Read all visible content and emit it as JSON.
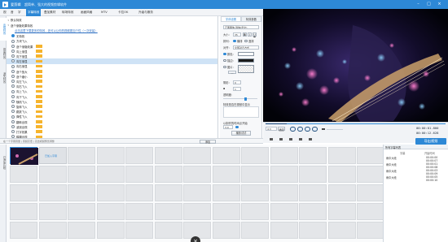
{
  "titlebar": {
    "app": "爱剪辑",
    "subtitle": "超简单、强大的视频剪辑软件"
  },
  "menu": [
    "视",
    "音",
    "字",
    "字幕特效",
    "叠加素材",
    "转场特效",
    "画面风格",
    "MTV",
    "卡拉OK",
    "升级与服务"
  ],
  "menu_active_index": 3,
  "left_tabs": [
    "出现特效",
    "停留特效",
    "消失特效"
  ],
  "effects": {
    "header": "默认特效",
    "group": "逐个渐隐效果特效",
    "promo": "点击这里下载更多的特效，还可以让你的视频更加个性（一次安装）",
    "items": [
      {
        "label": "无特效",
        "tag": false,
        "indent": 1,
        "checked": true
      },
      {
        "label": "方块飞入",
        "tag": false,
        "indent": 1,
        "checked": false
      },
      {
        "label": "逐个渐隐效果",
        "tag": true,
        "indent": 1,
        "checked": false
      },
      {
        "label": "向上渐显",
        "tag": true,
        "indent": 1,
        "checked": false
      },
      {
        "label": "向下渐显",
        "tag": true,
        "indent": 1,
        "checked": false
      },
      {
        "label": "向左渐显",
        "tag": true,
        "indent": 1,
        "checked": false
      },
      {
        "label": "向右渐显",
        "tag": true,
        "indent": 1,
        "checked": false
      },
      {
        "label": "逐个放大",
        "tag": true,
        "indent": 1,
        "checked": false
      },
      {
        "label": "逐个缩小",
        "tag": true,
        "indent": 1,
        "checked": false
      },
      {
        "label": "向左飞入",
        "tag": true,
        "indent": 1,
        "checked": false
      },
      {
        "label": "向右飞入",
        "tag": true,
        "indent": 1,
        "checked": false
      },
      {
        "label": "向上飞入",
        "tag": true,
        "indent": 1,
        "checked": false
      },
      {
        "label": "向下飞入",
        "tag": true,
        "indent": 1,
        "checked": false
      },
      {
        "label": "随机飞入",
        "tag": true,
        "indent": 1,
        "checked": false
      },
      {
        "label": "旋转飞入",
        "tag": true,
        "indent": 1,
        "checked": false
      },
      {
        "label": "跳跃飞入",
        "tag": true,
        "indent": 1,
        "checked": false
      },
      {
        "label": "弹性飞入",
        "tag": true,
        "indent": 1,
        "checked": false
      },
      {
        "label": "翻转出现",
        "tag": true,
        "indent": 1,
        "checked": false
      },
      {
        "label": "波浪出现",
        "tag": true,
        "indent": 1,
        "checked": false
      },
      {
        "label": "打字效果",
        "tag": true,
        "indent": 1,
        "checked": false
      },
      {
        "label": "模糊出现",
        "tag": true,
        "indent": 1,
        "checked": false
      }
    ],
    "selected_index": 5
  },
  "props": {
    "tabs": [
      "字体设置",
      "特效参数"
    ],
    "font_select": "正黑黑体-简体(华文)",
    "size_label": "大小：",
    "size_value": "35",
    "align_label": "排列：",
    "align_h": "横排",
    "align_v": "竖排",
    "anchor_label": "对齐：",
    "anchor_value": "全部对齐方式",
    "color_label": "颜色：",
    "shadow_label": "描边：",
    "bg_label": "图片：",
    "font_color": "#ffffff",
    "stroke_color": "#1a1a1a",
    "shadow_label2": "阴影：",
    "opacity_label": "透明度：",
    "opt1": "特效是否在视频中显示",
    "opt2": "打开字幕显示位置",
    "bottom_label": "以制作的时间点开始",
    "duration_value": "3.0",
    "apply_btn": "播放试试"
  },
  "player": {
    "ratio": "4:3",
    "fit": "适应",
    "current_time": "00:00:01.800",
    "total_time": "00:00:12.628"
  },
  "addbar": {
    "hint": "在一个字幕音量 | 音频高低 | 双击视频预览调整",
    "add_btn": "添加"
  },
  "timeline": {
    "left_label": "已添加片段",
    "clip_label": "已加入字幕"
  },
  "export": {
    "label": "导出视频"
  },
  "rightpanel": {
    "header": "所有字幕列表",
    "cols": [
      "字幕",
      "开始时间"
    ],
    "rows": [
      {
        "name": "雨中大段",
        "time": "00:00:00"
      },
      {
        "name": "雨中大段",
        "time": "00:00:01"
      },
      {
        "name": "雨中大段",
        "time": "00:00:03"
      },
      {
        "name": "雨中大段",
        "time": "00:00:05"
      }
    ],
    "extra_times": [
      "00:00:07",
      "00:00:08",
      "00:00:09",
      "00:00:10"
    ]
  },
  "colors": {
    "accent": "#2d88d6",
    "tag": "#f6b42d",
    "preview_bg": "#05060f"
  }
}
